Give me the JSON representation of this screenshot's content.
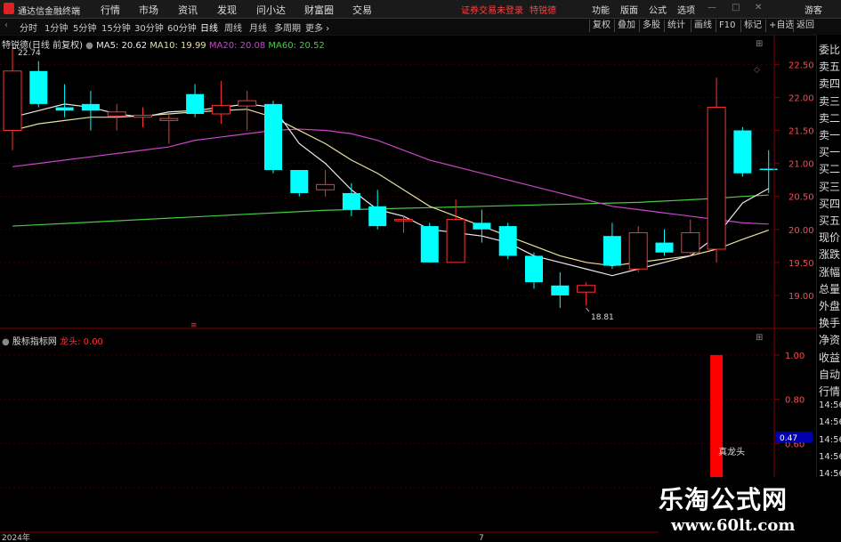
{
  "app": {
    "name": "通达信金融终端"
  },
  "menu": [
    "行情",
    "市场",
    "资讯",
    "发现",
    "问小达",
    "财富圈",
    "交易"
  ],
  "notice": {
    "login": "证券交易未登录",
    "stock": "特锐德"
  },
  "menu_right": [
    "功能",
    "版面",
    "公式",
    "选项"
  ],
  "guest": "游客",
  "periods": [
    "分时",
    "1分钟",
    "5分钟",
    "15分钟",
    "30分钟",
    "60分钟",
    "日线",
    "周线",
    "月线",
    "多周期",
    "更多 ›"
  ],
  "active_period": "日线",
  "right_buttons": [
    "复权",
    "叠加",
    "多股",
    "统计",
    "画线",
    "F10",
    "标记",
    "+自选",
    "返回"
  ],
  "main_legend": {
    "title": "特锐德(日线 前复权)",
    "ma5": "MA5: 20.62",
    "ma10": "MA10: 19.99",
    "ma20": "MA20: 20.08",
    "ma60": "MA60: 20.52"
  },
  "high_label": "22.74",
  "low_label": "18.81",
  "indicator": {
    "name": "股标指标网",
    "label": "龙头: 0.00",
    "signal_text": "真龙头",
    "value_tag": "0.47"
  },
  "date_labels": [
    "2024年",
    "7"
  ],
  "side_labels": [
    "委比",
    "卖五",
    "卖四",
    "卖三",
    "卖二",
    "卖一",
    "买一",
    "买二",
    "买三",
    "买四",
    "买五",
    "现价",
    "涨跌",
    "涨幅",
    "总量",
    "外盘",
    "换手",
    "净资",
    "收益",
    "自动",
    "行情",
    "14:56",
    "14:56",
    "14:56",
    "14:56",
    "14:56",
    "14:56"
  ],
  "colors": {
    "up": "#ff3232",
    "down": "#00ffff",
    "ma5": "#e8e8e8",
    "ma10": "#e8e0a0",
    "ma20": "#cc44cc",
    "ma60": "#44cc44"
  },
  "chart_data": {
    "type": "candlestick",
    "price_axis": {
      "ticks": [
        22.5,
        22.0,
        21.5,
        21.0,
        20.5,
        20.0,
        19.5,
        19.0
      ],
      "range": [
        18.5,
        22.95
      ]
    },
    "indicator_axis": {
      "ticks": [
        1.0,
        0.8,
        0.6,
        0.4
      ],
      "range": [
        0.2,
        1.08
      ]
    },
    "candles": [
      {
        "o": 21.5,
        "c": 22.4,
        "h": 22.74,
        "l": 21.2
      },
      {
        "o": 22.4,
        "c": 21.9,
        "h": 22.55,
        "l": 21.85
      },
      {
        "o": 21.85,
        "c": 21.8,
        "h": 22.2,
        "l": 21.7
      },
      {
        "o": 21.9,
        "c": 21.8,
        "h": 22.1,
        "l": 21.5
      },
      {
        "o": 21.72,
        "c": 21.78,
        "h": 21.9,
        "l": 21.5
      },
      {
        "o": 21.7,
        "c": 21.73,
        "h": 21.85,
        "l": 21.55
      },
      {
        "o": 21.65,
        "c": 21.68,
        "h": 21.75,
        "l": 21.3
      },
      {
        "o": 22.05,
        "c": 21.75,
        "h": 22.2,
        "l": 21.7
      },
      {
        "o": 21.75,
        "c": 21.88,
        "h": 22.25,
        "l": 21.6
      },
      {
        "o": 21.87,
        "c": 21.95,
        "h": 22.1,
        "l": 21.5
      },
      {
        "o": 21.9,
        "c": 20.9,
        "h": 21.95,
        "l": 20.85
      },
      {
        "o": 20.9,
        "c": 20.55,
        "h": 20.9,
        "l": 20.5
      },
      {
        "o": 20.6,
        "c": 20.68,
        "h": 20.9,
        "l": 20.5
      },
      {
        "o": 20.55,
        "c": 20.3,
        "h": 20.7,
        "l": 20.2
      },
      {
        "o": 20.35,
        "c": 20.05,
        "h": 20.6,
        "l": 20.0
      },
      {
        "o": 20.15,
        "c": 20.15,
        "h": 20.2,
        "l": 19.95
      },
      {
        "o": 20.05,
        "c": 19.5,
        "h": 20.1,
        "l": 19.5
      },
      {
        "o": 19.5,
        "c": 20.15,
        "h": 20.45,
        "l": 19.5
      },
      {
        "o": 20.1,
        "c": 20.0,
        "h": 20.3,
        "l": 19.8
      },
      {
        "o": 20.05,
        "c": 19.6,
        "h": 20.1,
        "l": 19.55
      },
      {
        "o": 19.6,
        "c": 19.2,
        "h": 19.65,
        "l": 19.1
      },
      {
        "o": 19.15,
        "c": 19.0,
        "h": 19.35,
        "l": 18.81
      },
      {
        "o": 19.05,
        "c": 19.15,
        "h": 19.2,
        "l": 18.85
      },
      {
        "o": 19.9,
        "c": 19.45,
        "h": 20.1,
        "l": 19.4
      },
      {
        "o": 19.4,
        "c": 19.95,
        "h": 20.05,
        "l": 19.35
      },
      {
        "o": 19.8,
        "c": 19.65,
        "h": 20.0,
        "l": 19.6
      },
      {
        "o": 19.65,
        "c": 19.95,
        "h": 20.15,
        "l": 19.6
      },
      {
        "o": 19.7,
        "c": 21.85,
        "h": 22.3,
        "l": 19.5
      },
      {
        "o": 21.5,
        "c": 20.85,
        "h": 21.55,
        "l": 20.8
      },
      {
        "o": 20.92,
        "c": 20.9,
        "h": 21.2,
        "l": 20.55
      }
    ],
    "ma5": [
      21.7,
      21.8,
      21.9,
      21.85,
      21.75,
      21.7,
      21.78,
      21.8,
      21.85,
      21.9,
      21.85,
      21.3,
      21.0,
      20.6,
      20.3,
      20.2,
      20.0,
      19.95,
      19.9,
      19.8,
      19.6,
      19.5,
      19.4,
      19.3,
      19.4,
      19.5,
      19.6,
      19.9,
      20.4,
      20.62
    ],
    "ma10": [
      21.5,
      21.6,
      21.65,
      21.7,
      21.7,
      21.72,
      21.75,
      21.78,
      21.8,
      21.82,
      21.7,
      21.5,
      21.3,
      21.05,
      20.85,
      20.6,
      20.35,
      20.2,
      20.05,
      19.9,
      19.75,
      19.6,
      19.5,
      19.45,
      19.5,
      19.55,
      19.6,
      19.7,
      19.85,
      19.99
    ],
    "ma20": [
      20.95,
      21.0,
      21.05,
      21.1,
      21.15,
      21.2,
      21.25,
      21.35,
      21.4,
      21.45,
      21.5,
      21.52,
      21.5,
      21.45,
      21.35,
      21.2,
      21.05,
      20.95,
      20.85,
      20.75,
      20.65,
      20.55,
      20.45,
      20.35,
      20.3,
      20.25,
      20.2,
      20.15,
      20.1,
      20.08
    ],
    "ma60": [
      20.05,
      20.07,
      20.09,
      20.11,
      20.13,
      20.15,
      20.17,
      20.19,
      20.21,
      20.23,
      20.25,
      20.27,
      20.29,
      20.3,
      20.31,
      20.32,
      20.33,
      20.34,
      20.35,
      20.36,
      20.37,
      20.38,
      20.39,
      20.4,
      20.41,
      20.43,
      20.45,
      20.47,
      20.5,
      20.52
    ],
    "indicator_bars": [
      {
        "index": 27,
        "value": 1.0
      }
    ]
  }
}
